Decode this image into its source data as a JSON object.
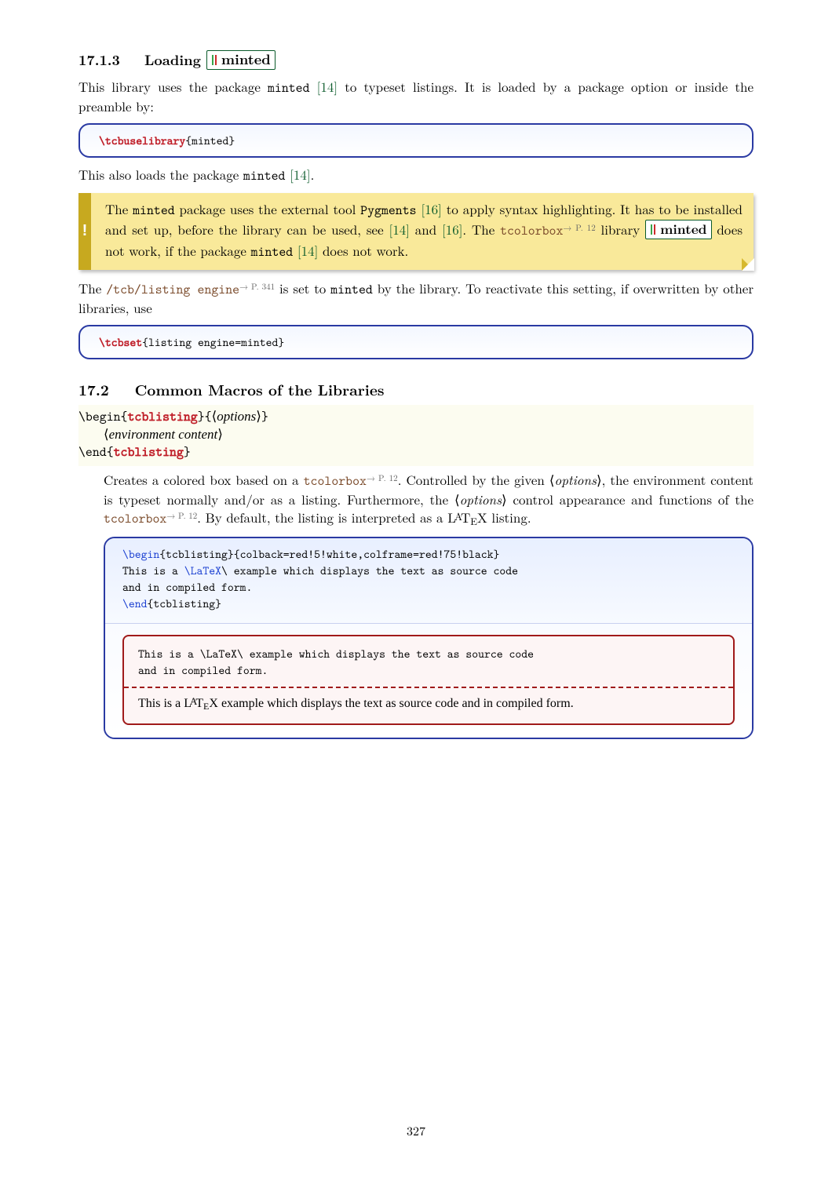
{
  "section_1713": {
    "number": "17.1.3",
    "title_pre": "Loading",
    "lib_name": "minted"
  },
  "para1": {
    "t1": "This library uses the package ",
    "pkg": "minted",
    "cite": "[14]",
    "t2": " to typeset listings. It is loaded by a package option or inside the preamble by:"
  },
  "code1": {
    "cs": "\\tcbuselibrary",
    "arg": "{minted}"
  },
  "para2": {
    "t1": "This also loads the package ",
    "pkg": "minted",
    "cite": "[14]",
    "t2": "."
  },
  "warn": {
    "bang": "!",
    "w1": "The ",
    "w_pkg": "minted",
    "w2": " package uses the external tool ",
    "w_tool": "Pygments",
    "w_cite1": "[16]",
    "w3": " to apply syntax highlighting. It has to be installed and set up, before the library can be used, see ",
    "w_cite2": "[14]",
    "w4": " and ",
    "w_cite3": "[16]",
    "w5": ". The ",
    "w_tcolor": "tcolorbox",
    "w_pref": "→ P. 12",
    "w6": " library ",
    "w7": " does not work, if the package ",
    "w_pkg2": "minted",
    "w_cite4": "[14]",
    "w8": " does not work."
  },
  "para3": {
    "t1": "The ",
    "key": "/tcb/listing engine",
    "pref": "→ P. 341",
    "t2": " is set to ",
    "val": "minted",
    "t3": " by the library. To reactivate this setting, if overwritten by other libraries, use"
  },
  "code2": {
    "cs": "\\tcbset",
    "arg": "{listing engine=minted}"
  },
  "section_172": {
    "number": "17.2",
    "title": "Common Macros of the Libraries"
  },
  "envdef": {
    "begin": "\\begin{",
    "name": "tcblisting",
    "beginend": "}{",
    "options": "options",
    "close": "}",
    "content": "environment content",
    "end": "\\end{",
    "endclose": "}"
  },
  "desc": {
    "d1": "Creates a colored box based on a ",
    "tcolor": "tcolorbox",
    "pref": "→ P. 12",
    "d2": ". Controlled by the given ⟨",
    "opt": "options",
    "d3": "⟩, the environment content is typeset normally and/or as a listing. Furthermore, the ⟨",
    "d4": "⟩ control appearance and functions of the ",
    "d5": ". By default, the listing is interpreted as a ",
    "latex": "LATEX",
    "d6": " listing."
  },
  "example": {
    "l1a": "\\begin",
    "l1b": "{tcblisting}{colback=red!5!white,colframe=red!75!black}",
    "l2a": "This is a ",
    "l2b": "\\LaTeX",
    "l2c": "\\ example which displays the text as source code",
    "l3": "and in compiled form.",
    "l4a": "\\end",
    "l4b": "{tcblisting}",
    "red_src1": "This is a \\LaTeX\\ example which displays the text as source code",
    "red_src2": "and in compiled form.",
    "red_out": "This is a LATEX example which displays the text as source code and in compiled form."
  },
  "page_number": "327"
}
